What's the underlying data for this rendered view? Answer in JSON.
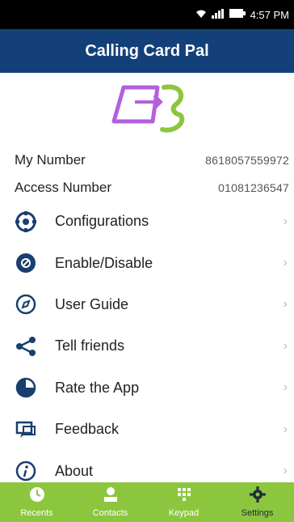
{
  "status_bar": {
    "time": "4:57 PM",
    "icons": [
      "wifi-icon",
      "signal-icon",
      "battery-icon"
    ]
  },
  "app": {
    "title": "Calling Card Pal"
  },
  "colors": {
    "app_bar": "#14407a",
    "nav_bar": "#8cc63f",
    "menu_icon": "#1a3e6e",
    "logo_purple": "#b260e0",
    "logo_green": "#8cc63f"
  },
  "info": {
    "my_number_label": "My Number",
    "my_number_value": "8618057559972",
    "access_number_label": "Access Number",
    "access_number_value": "01081236547"
  },
  "menu": {
    "items": [
      {
        "label": "Configurations",
        "icon": "gear-icon"
      },
      {
        "label": "Enable/Disable",
        "icon": "power-icon"
      },
      {
        "label": "User Guide",
        "icon": "compass-icon"
      },
      {
        "label": "Tell friends",
        "icon": "share-icon"
      },
      {
        "label": "Rate the App",
        "icon": "rate-icon"
      },
      {
        "label": "Feedback",
        "icon": "feedback-icon"
      },
      {
        "label": "About",
        "icon": "info-icon"
      }
    ]
  },
  "bottom_nav": {
    "tabs": [
      {
        "label": "Recents",
        "icon": "clock-icon"
      },
      {
        "label": "Contacts",
        "icon": "person-icon"
      },
      {
        "label": "Keypad",
        "icon": "keypad-icon"
      },
      {
        "label": "Settings",
        "icon": "settings-icon"
      }
    ],
    "active": "Settings"
  }
}
